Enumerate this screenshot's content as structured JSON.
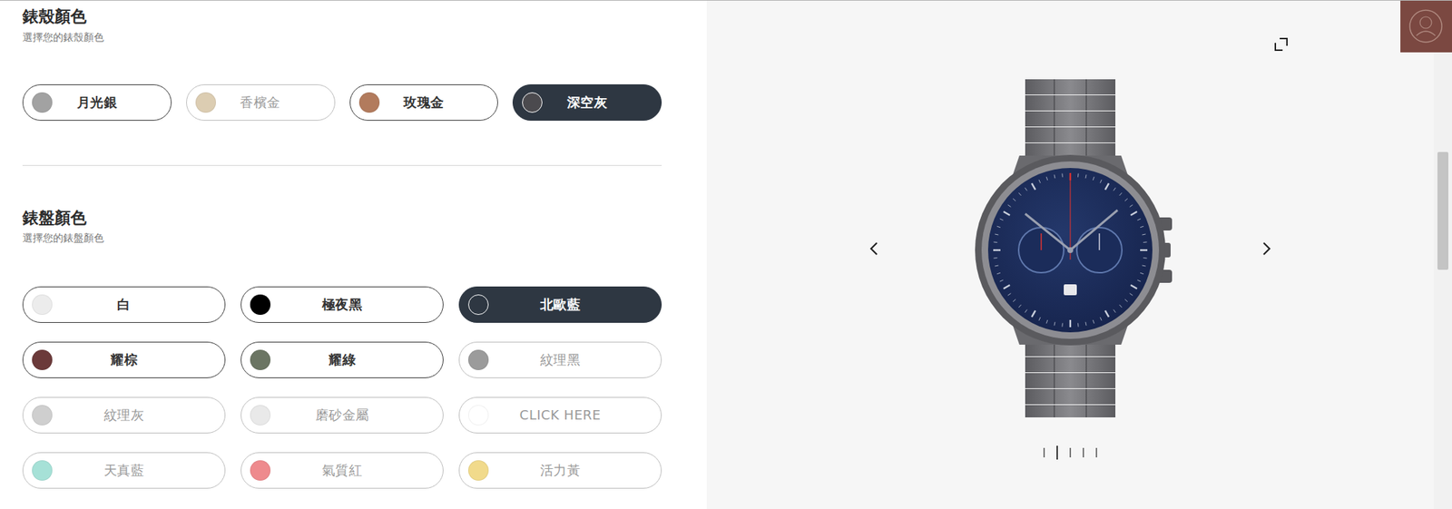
{
  "case_color": {
    "title": "錶殼顏色",
    "subtitle": "選擇您的錶殼顏色",
    "options": [
      {
        "label": "月光銀",
        "color": "#a2a2a2",
        "selected": false,
        "disabled": false
      },
      {
        "label": "香檳金",
        "color": "#dccdb2",
        "selected": false,
        "disabled": true
      },
      {
        "label": "玫瑰金",
        "color": "#b27b5d",
        "selected": false,
        "disabled": false
      },
      {
        "label": "深空灰",
        "color": "#4b4a4e",
        "selected": true,
        "disabled": false
      }
    ]
  },
  "dial_color": {
    "title": "錶盤顏色",
    "subtitle": "選擇您的錶盤顏色",
    "options": [
      {
        "label": "白",
        "color": "#ececec",
        "selected": false,
        "disabled": false
      },
      {
        "label": "極夜黑",
        "color": "#000000",
        "selected": false,
        "disabled": false
      },
      {
        "label": "北歐藍",
        "color": "#2e3742",
        "selected": true,
        "disabled": false
      },
      {
        "label": "耀棕",
        "color": "#6b3a3a",
        "selected": false,
        "disabled": false
      },
      {
        "label": "耀綠",
        "color": "#6b7563",
        "selected": false,
        "disabled": false
      },
      {
        "label": "紋理黑",
        "color": "#9b9b9b",
        "selected": false,
        "disabled": true
      },
      {
        "label": "紋理灰",
        "color": "#cfcfcf",
        "selected": false,
        "disabled": true
      },
      {
        "label": "磨砂金屬",
        "color": "#e9e9e9",
        "selected": false,
        "disabled": true
      },
      {
        "label": "CLICK HERE",
        "color": "#ffffff",
        "selected": false,
        "disabled": true
      },
      {
        "label": "天真藍",
        "color": "#a6e1d7",
        "selected": false,
        "disabled": true
      },
      {
        "label": "氣質紅",
        "color": "#ee8a8d",
        "selected": false,
        "disabled": true
      },
      {
        "label": "活力黃",
        "color": "#f1da8b",
        "selected": false,
        "disabled": true
      }
    ]
  },
  "gallery": {
    "slides": [
      {
        "selected": false
      },
      {
        "selected": true
      },
      {
        "selected": false
      },
      {
        "selected": false
      },
      {
        "selected": false
      }
    ]
  }
}
